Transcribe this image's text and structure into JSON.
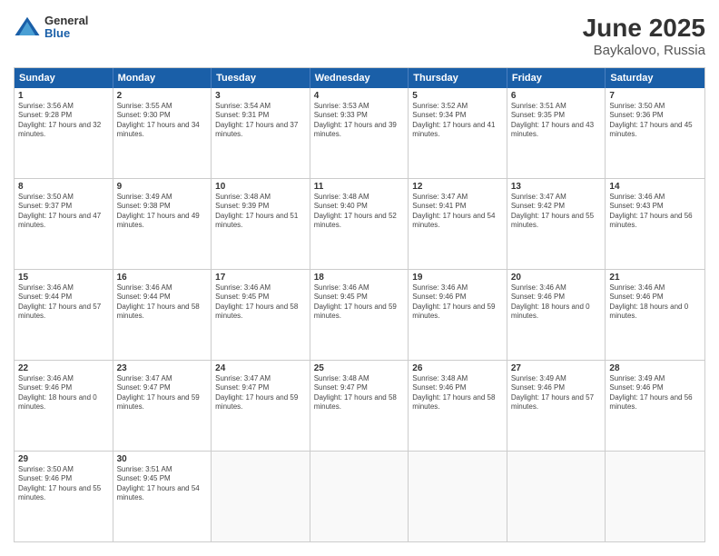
{
  "header": {
    "logo": {
      "general": "General",
      "blue": "Blue"
    },
    "title": "June 2025",
    "subtitle": "Baykalovo, Russia"
  },
  "calendar": {
    "days": [
      "Sunday",
      "Monday",
      "Tuesday",
      "Wednesday",
      "Thursday",
      "Friday",
      "Saturday"
    ],
    "rows": [
      [
        {
          "day": "1",
          "sunrise": "3:56 AM",
          "sunset": "9:28 PM",
          "daylight": "17 hours and 32 minutes."
        },
        {
          "day": "2",
          "sunrise": "3:55 AM",
          "sunset": "9:30 PM",
          "daylight": "17 hours and 34 minutes."
        },
        {
          "day": "3",
          "sunrise": "3:54 AM",
          "sunset": "9:31 PM",
          "daylight": "17 hours and 37 minutes."
        },
        {
          "day": "4",
          "sunrise": "3:53 AM",
          "sunset": "9:33 PM",
          "daylight": "17 hours and 39 minutes."
        },
        {
          "day": "5",
          "sunrise": "3:52 AM",
          "sunset": "9:34 PM",
          "daylight": "17 hours and 41 minutes."
        },
        {
          "day": "6",
          "sunrise": "3:51 AM",
          "sunset": "9:35 PM",
          "daylight": "17 hours and 43 minutes."
        },
        {
          "day": "7",
          "sunrise": "3:50 AM",
          "sunset": "9:36 PM",
          "daylight": "17 hours and 45 minutes."
        }
      ],
      [
        {
          "day": "8",
          "sunrise": "3:50 AM",
          "sunset": "9:37 PM",
          "daylight": "17 hours and 47 minutes."
        },
        {
          "day": "9",
          "sunrise": "3:49 AM",
          "sunset": "9:38 PM",
          "daylight": "17 hours and 49 minutes."
        },
        {
          "day": "10",
          "sunrise": "3:48 AM",
          "sunset": "9:39 PM",
          "daylight": "17 hours and 51 minutes."
        },
        {
          "day": "11",
          "sunrise": "3:48 AM",
          "sunset": "9:40 PM",
          "daylight": "17 hours and 52 minutes."
        },
        {
          "day": "12",
          "sunrise": "3:47 AM",
          "sunset": "9:41 PM",
          "daylight": "17 hours and 54 minutes."
        },
        {
          "day": "13",
          "sunrise": "3:47 AM",
          "sunset": "9:42 PM",
          "daylight": "17 hours and 55 minutes."
        },
        {
          "day": "14",
          "sunrise": "3:46 AM",
          "sunset": "9:43 PM",
          "daylight": "17 hours and 56 minutes."
        }
      ],
      [
        {
          "day": "15",
          "sunrise": "3:46 AM",
          "sunset": "9:44 PM",
          "daylight": "17 hours and 57 minutes."
        },
        {
          "day": "16",
          "sunrise": "3:46 AM",
          "sunset": "9:44 PM",
          "daylight": "17 hours and 58 minutes."
        },
        {
          "day": "17",
          "sunrise": "3:46 AM",
          "sunset": "9:45 PM",
          "daylight": "17 hours and 58 minutes."
        },
        {
          "day": "18",
          "sunrise": "3:46 AM",
          "sunset": "9:45 PM",
          "daylight": "17 hours and 59 minutes."
        },
        {
          "day": "19",
          "sunrise": "3:46 AM",
          "sunset": "9:46 PM",
          "daylight": "17 hours and 59 minutes."
        },
        {
          "day": "20",
          "sunrise": "3:46 AM",
          "sunset": "9:46 PM",
          "daylight": "18 hours and 0 minutes."
        },
        {
          "day": "21",
          "sunrise": "3:46 AM",
          "sunset": "9:46 PM",
          "daylight": "18 hours and 0 minutes."
        }
      ],
      [
        {
          "day": "22",
          "sunrise": "3:46 AM",
          "sunset": "9:46 PM",
          "daylight": "18 hours and 0 minutes."
        },
        {
          "day": "23",
          "sunrise": "3:47 AM",
          "sunset": "9:47 PM",
          "daylight": "17 hours and 59 minutes."
        },
        {
          "day": "24",
          "sunrise": "3:47 AM",
          "sunset": "9:47 PM",
          "daylight": "17 hours and 59 minutes."
        },
        {
          "day": "25",
          "sunrise": "3:48 AM",
          "sunset": "9:47 PM",
          "daylight": "17 hours and 58 minutes."
        },
        {
          "day": "26",
          "sunrise": "3:48 AM",
          "sunset": "9:46 PM",
          "daylight": "17 hours and 58 minutes."
        },
        {
          "day": "27",
          "sunrise": "3:49 AM",
          "sunset": "9:46 PM",
          "daylight": "17 hours and 57 minutes."
        },
        {
          "day": "28",
          "sunrise": "3:49 AM",
          "sunset": "9:46 PM",
          "daylight": "17 hours and 56 minutes."
        }
      ],
      [
        {
          "day": "29",
          "sunrise": "3:50 AM",
          "sunset": "9:46 PM",
          "daylight": "17 hours and 55 minutes."
        },
        {
          "day": "30",
          "sunrise": "3:51 AM",
          "sunset": "9:45 PM",
          "daylight": "17 hours and 54 minutes."
        },
        {
          "day": "",
          "sunrise": "",
          "sunset": "",
          "daylight": ""
        },
        {
          "day": "",
          "sunrise": "",
          "sunset": "",
          "daylight": ""
        },
        {
          "day": "",
          "sunrise": "",
          "sunset": "",
          "daylight": ""
        },
        {
          "day": "",
          "sunrise": "",
          "sunset": "",
          "daylight": ""
        },
        {
          "day": "",
          "sunrise": "",
          "sunset": "",
          "daylight": ""
        }
      ]
    ]
  }
}
